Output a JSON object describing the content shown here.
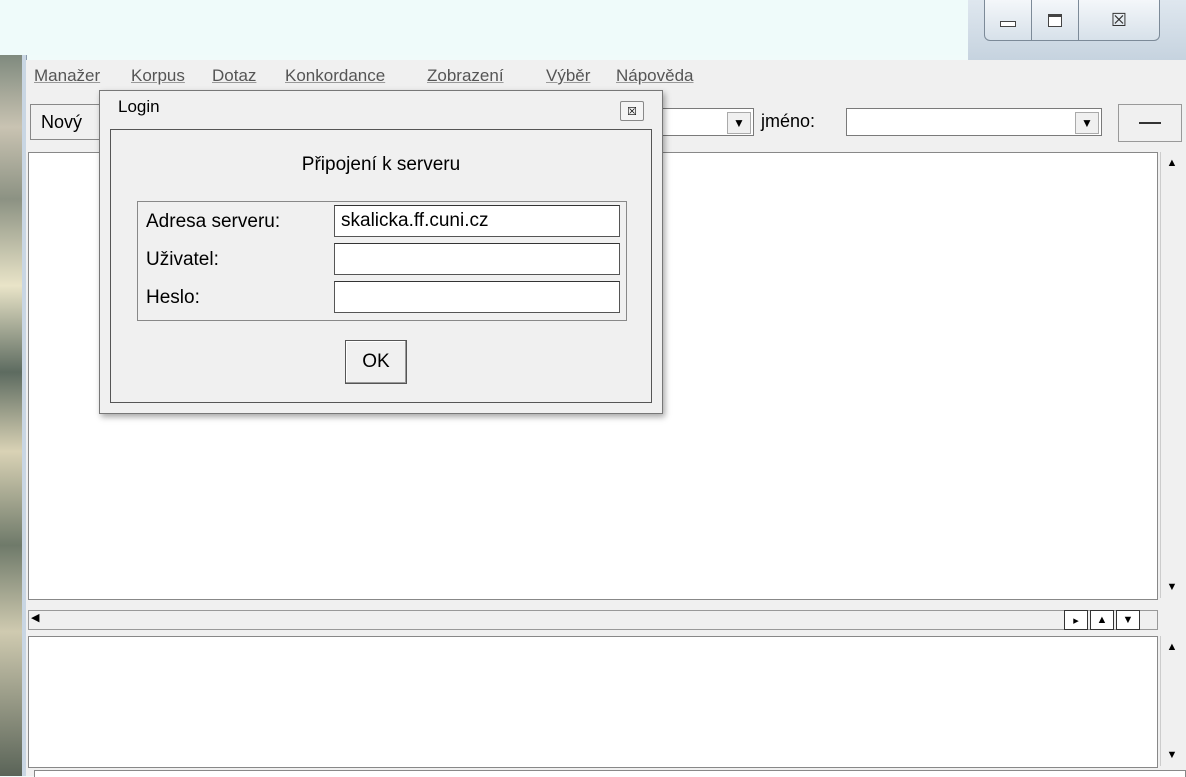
{
  "window_controls": {
    "minimize_icon": "minimize-icon",
    "maximize_icon": "maximize-icon",
    "close_symbol": "☒"
  },
  "menubar": {
    "items": [
      "Manažer",
      "Korpus",
      "Dotaz",
      "Konkordance",
      "Zobrazení",
      "Výběr",
      "Nápověda"
    ]
  },
  "toolbar": {
    "new_button_label": "Nový",
    "name_label": "jméno:",
    "combo1_value": "",
    "combo2_value": ""
  },
  "dialog": {
    "title": "Login",
    "close_symbol": "☒",
    "heading": "Připojení k serveru",
    "fields": [
      {
        "label": "Adresa serveru:",
        "value": "skalicka.ff.cuni.cz"
      },
      {
        "label": "Uživatel:",
        "value": ""
      },
      {
        "label": "Heslo:",
        "value": ""
      }
    ],
    "ok_label": "OK"
  }
}
